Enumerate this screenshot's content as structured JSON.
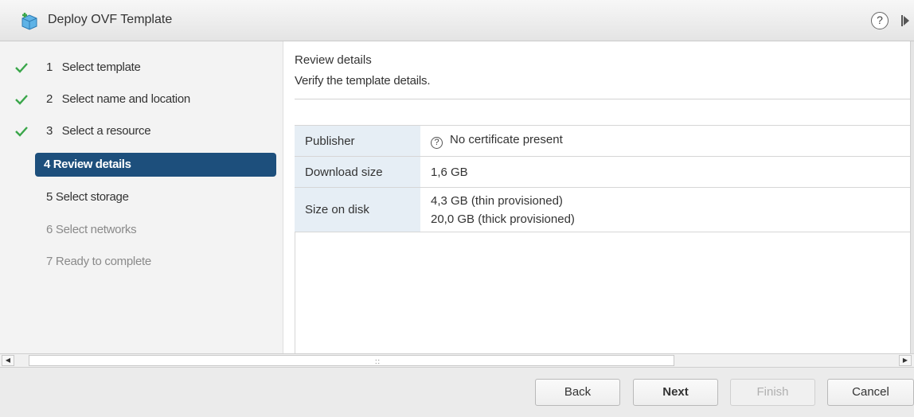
{
  "window": {
    "title": "Deploy OVF Template",
    "help_glyph": "?",
    "icons": {
      "app": "deploy-template-icon",
      "help": "help-icon",
      "collapse": "collapse-panel-icon"
    }
  },
  "steps": [
    {
      "number": "1",
      "label": "Select template",
      "state": "completed"
    },
    {
      "number": "2",
      "label": "Select name and location",
      "state": "completed"
    },
    {
      "number": "3",
      "label": "Select a resource",
      "state": "completed"
    },
    {
      "number": "4",
      "label": "Review details",
      "state": "current"
    },
    {
      "number": "5",
      "label": "Select storage",
      "state": "pending"
    },
    {
      "number": "6",
      "label": "Select networks",
      "state": "disabled"
    },
    {
      "number": "7",
      "label": "Ready to complete",
      "state": "disabled"
    }
  ],
  "content": {
    "title": "Review details",
    "subtitle": "Verify the template details.",
    "details": [
      {
        "key": "Publisher",
        "value": "No certificate present",
        "icon": "question-circle-icon"
      },
      {
        "key": "Download size",
        "value": "1,6 GB"
      },
      {
        "key": "Size on disk",
        "value_lines": [
          "4,3 GB (thin provisioned)",
          "20,0 GB (thick provisioned)"
        ]
      }
    ]
  },
  "buttons": {
    "back": "Back",
    "next": "Next",
    "finish": "Finish",
    "cancel": "Cancel"
  },
  "colors": {
    "accent": "#1d4f7c",
    "check": "#3aa64a",
    "key_cell": "#e6eef5"
  }
}
